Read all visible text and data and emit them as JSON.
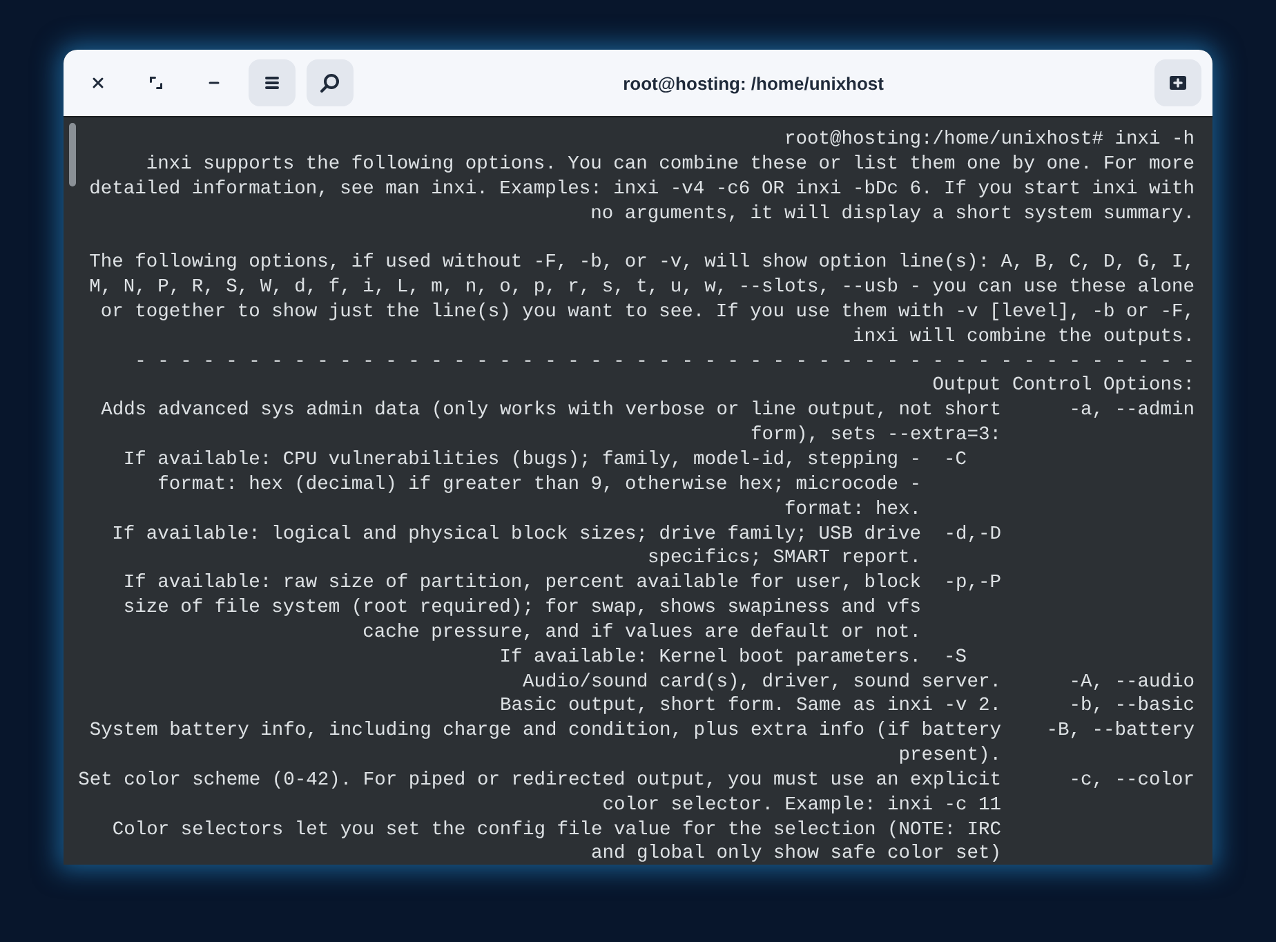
{
  "window": {
    "title": "root@hosting: /home/unixhost"
  },
  "terminal": {
    "prompt": "root@hosting:/home/unixhost# inxi -h",
    "paragraphs": [
      [
        "inxi supports the following options. You can combine these or list them one by one. For more",
        "detailed information, see man inxi. Examples: inxi -v4 -c6 OR inxi -bDc 6. If you start inxi with",
        "no arguments, it will display a short system summary."
      ],
      [
        "The following options, if used without -F, -b, or -v, will show option line(s): A, B, C, D, G, I,",
        "M, N, P, R, S, W, d, f, i, L, m, n, o, p, r, s, t, u, w, --slots, --usb - you can use these alone",
        "or together to show just the line(s) you want to see. If you use them with -v [level], -b or -F,",
        "inxi will combine the outputs."
      ]
    ],
    "separator": "- - - - - - - - - - - - - - - - - - - - - - - - - - - - - - - - - - - - - - - - - - - - - - -",
    "section_heading": "Output Control Options:",
    "options": [
      {
        "flag": "-a, --admin",
        "lines": [
          "Adds advanced sys admin data (only works with verbose or line output, not short",
          "form), sets --extra=3:"
        ],
        "sub_options": [
          {
            "flag": "-C",
            "lines": [
              "If available: CPU vulnerabilities (bugs); family, model-id, stepping -",
              "format: hex (decimal) if greater than 9, otherwise hex; microcode -",
              "format: hex."
            ]
          },
          {
            "flag": "-d,-D",
            "lines": [
              "If available: logical and physical block sizes; drive family; USB drive",
              "specifics; SMART report."
            ]
          },
          {
            "flag": "-p,-P",
            "lines": [
              "If available: raw size of partition, percent available for user, block",
              "size of file system (root required); for swap, shows swapiness and vfs",
              "cache pressure, and if values are default or not."
            ]
          },
          {
            "flag": "-S",
            "lines": [
              "If available: Kernel boot parameters."
            ]
          }
        ]
      },
      {
        "flag": "-A, --audio",
        "lines": [
          "Audio/sound card(s), driver, sound server."
        ]
      },
      {
        "flag": "-b, --basic",
        "lines": [
          "Basic output, short form. Same as inxi -v 2."
        ]
      },
      {
        "flag": "-B, --battery",
        "lines": [
          "System battery info, including charge and condition, plus extra info (if battery",
          "present)."
        ]
      },
      {
        "flag": "-c, --color",
        "lines": [
          "Set color scheme (0-42). For piped or redirected output, you must use an explicit",
          "color selector. Example: inxi -c 11",
          "Color selectors let you set the config file value for the selection (NOTE: IRC",
          "and global only show safe color set)"
        ]
      }
    ]
  }
}
